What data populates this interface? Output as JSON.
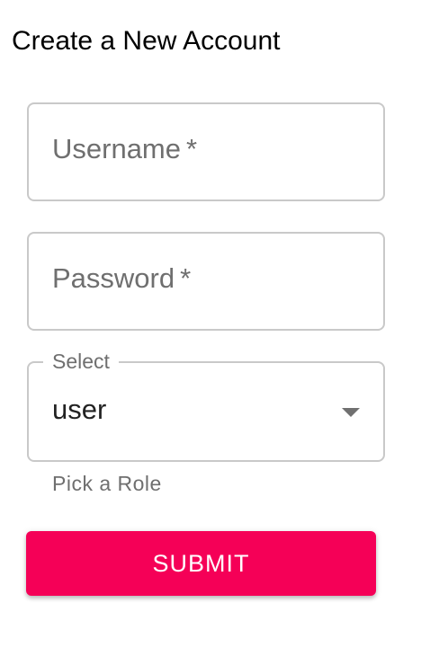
{
  "page": {
    "title": "Create a New Account"
  },
  "form": {
    "username": {
      "placeholder": "Username",
      "required_marker": "*",
      "value": ""
    },
    "password": {
      "placeholder": "Password",
      "required_marker": "*",
      "value": ""
    },
    "role_select": {
      "label": "Select",
      "selected_value": "user",
      "helper_text": "Pick a Role",
      "icon": "dropdown-arrow-icon"
    },
    "submit_label": "SUBMIT"
  },
  "colors": {
    "accent": "#f50057",
    "border": "#c9c9c9",
    "placeholder": "#6f6f6f",
    "background": "#ffffff"
  }
}
